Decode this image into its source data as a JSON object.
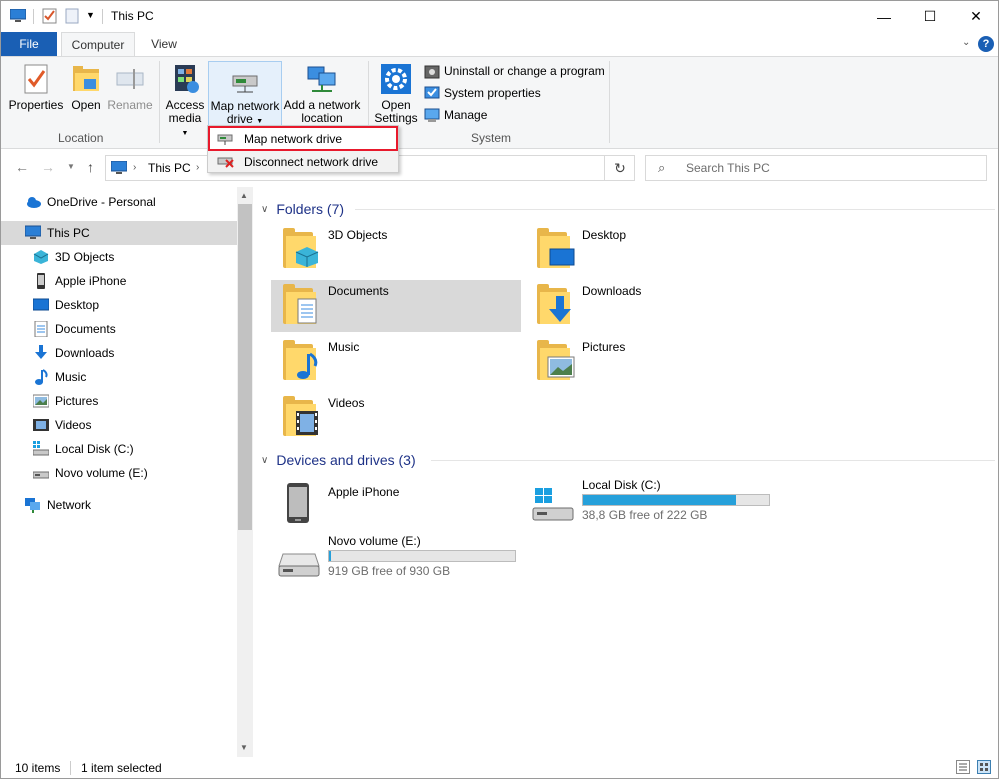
{
  "window": {
    "title": "This PC"
  },
  "ribbon_tabs": [
    "File",
    "Computer",
    "View"
  ],
  "ribbon": {
    "location": {
      "properties": "Properties",
      "open": "Open",
      "rename": "Rename",
      "group_label": "Location"
    },
    "network": {
      "access_media": [
        "Access",
        "media"
      ],
      "map_network_drive": [
        "Map network",
        "drive"
      ],
      "add_network_location": [
        "Add a network",
        "location"
      ]
    },
    "system": {
      "open_settings": [
        "Open",
        "Settings"
      ],
      "uninstall": "Uninstall or change a program",
      "system_properties": "System properties",
      "manage": "Manage",
      "group_label": "System"
    }
  },
  "menu": {
    "map_network_drive": "Map network drive",
    "disconnect_network_drive": "Disconnect network drive"
  },
  "address": {
    "path": "This PC",
    "search_placeholder": "Search This PC"
  },
  "nav": {
    "items": [
      {
        "label": "OneDrive - Personal",
        "icon": "cloud-icon"
      },
      {
        "label": "This PC",
        "icon": "computer-icon",
        "selected": true
      },
      {
        "label": "3D Objects",
        "icon": "cube-icon"
      },
      {
        "label": "Apple iPhone",
        "icon": "phone-icon"
      },
      {
        "label": "Desktop",
        "icon": "desktop-icon"
      },
      {
        "label": "Documents",
        "icon": "document-icon"
      },
      {
        "label": "Downloads",
        "icon": "download-icon"
      },
      {
        "label": "Music",
        "icon": "music-icon"
      },
      {
        "label": "Pictures",
        "icon": "picture-icon"
      },
      {
        "label": "Videos",
        "icon": "video-icon"
      },
      {
        "label": "Local Disk (C:)",
        "icon": "local-disk-icon"
      },
      {
        "label": "Novo volume (E:)",
        "icon": "drive-icon"
      },
      {
        "label": "Network",
        "icon": "network-icon"
      }
    ]
  },
  "content": {
    "folders_header": "Folders (7)",
    "folders": [
      {
        "label": "3D Objects",
        "icon": "3d-objects-folder-icon"
      },
      {
        "label": "Desktop",
        "icon": "desktop-folder-icon"
      },
      {
        "label": "Documents",
        "icon": "documents-folder-icon",
        "selected": true
      },
      {
        "label": "Downloads",
        "icon": "downloads-folder-icon"
      },
      {
        "label": "Music",
        "icon": "music-folder-icon"
      },
      {
        "label": "Pictures",
        "icon": "pictures-folder-icon"
      },
      {
        "label": "Videos",
        "icon": "videos-folder-icon"
      }
    ],
    "drives_header": "Devices and drives (3)",
    "drives": [
      {
        "label": "Apple iPhone",
        "icon": "iphone-device-icon"
      },
      {
        "label": "Local Disk (C:)",
        "free": "38,8 GB free of 222 GB",
        "used_fraction": 0.825,
        "icon": "windows-drive-icon"
      },
      {
        "label": "Novo volume (E:)",
        "free": "919 GB free of 930 GB",
        "used_fraction": 0.012,
        "icon": "hard-drive-icon"
      }
    ]
  },
  "status": {
    "items": "10 items",
    "selected": "1 item selected"
  },
  "colors": {
    "accent": "#1a5fb4",
    "selection": "#d9d9d9",
    "header_text": "#1e3287",
    "drive_bar": "#26a0da",
    "highlight_outline": "#e8192c"
  }
}
